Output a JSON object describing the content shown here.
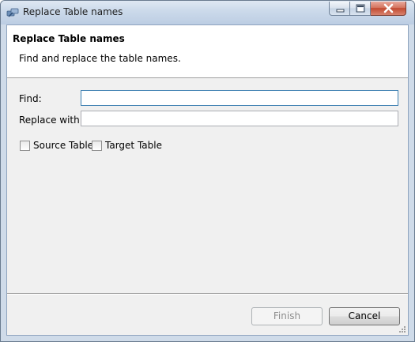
{
  "window": {
    "title": "Replace Table names",
    "controls": {
      "minimize": "minimize",
      "maximize": "maximize",
      "close": "close"
    }
  },
  "banner": {
    "title": "Replace Table names",
    "description": "Find and replace the table names."
  },
  "form": {
    "find_label": "Find:",
    "find_value": "",
    "replace_label": "Replace with:",
    "replace_value": ""
  },
  "options": {
    "source_table": {
      "label": "Source Table",
      "checked": false
    },
    "target_table": {
      "label": "Target Table",
      "checked": false
    }
  },
  "buttons": {
    "finish": "Finish",
    "cancel": "Cancel"
  },
  "colors": {
    "banner_bg": "#ffffff",
    "dialog_bg": "#f0f0f0",
    "focus_border": "#3c7fb1",
    "disabled_text": "#8d8d8d"
  }
}
